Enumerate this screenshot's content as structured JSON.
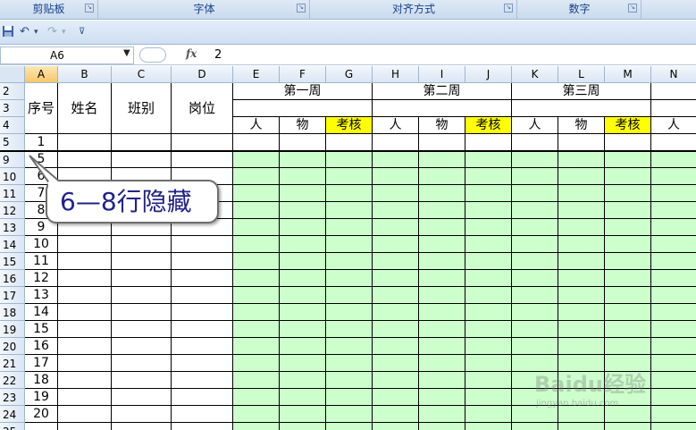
{
  "ribbon": {
    "groups": [
      "剪贴板",
      "字体",
      "对齐方式",
      "数字"
    ]
  },
  "quick_access": {
    "icons": [
      "save-icon",
      "undo-icon",
      "undo-dropdown-icon",
      "redo-icon",
      "redo-dropdown-icon",
      "customize-icon"
    ]
  },
  "formula_bar": {
    "name_box": "A6",
    "fx_label": "fx",
    "value": "2"
  },
  "sheet": {
    "columns": [
      "A",
      "B",
      "C",
      "D",
      "E",
      "F",
      "G",
      "H",
      "I",
      "J",
      "K",
      "L",
      "M",
      "N"
    ],
    "rows": [
      "2",
      "3",
      "4",
      "5",
      "9",
      "10",
      "11",
      "12",
      "13",
      "14",
      "15",
      "16",
      "17",
      "18",
      "19",
      "20",
      "21",
      "22",
      "23",
      "24",
      "25"
    ],
    "header_cells": {
      "seq": "序号",
      "name": "姓名",
      "class": "班别",
      "post": "岗位",
      "week1": "第一周",
      "week2": "第二周",
      "week3": "第三周",
      "person": "人",
      "thing": "物",
      "assess": "考核"
    },
    "seq_values": [
      "1",
      "5",
      "6",
      "7",
      "8",
      "9",
      "10",
      "11",
      "12",
      "13",
      "14",
      "15",
      "16",
      "17",
      "18",
      "19",
      "20"
    ]
  },
  "callout": {
    "text": "6—8行隐藏"
  },
  "watermark": {
    "brand": "Baidu经验",
    "url": "jingyan.baidu.com"
  },
  "colors": {
    "fill_green": "#ccffcc",
    "fill_yellow": "#ffff00",
    "selected_header": "#f6c86a"
  }
}
